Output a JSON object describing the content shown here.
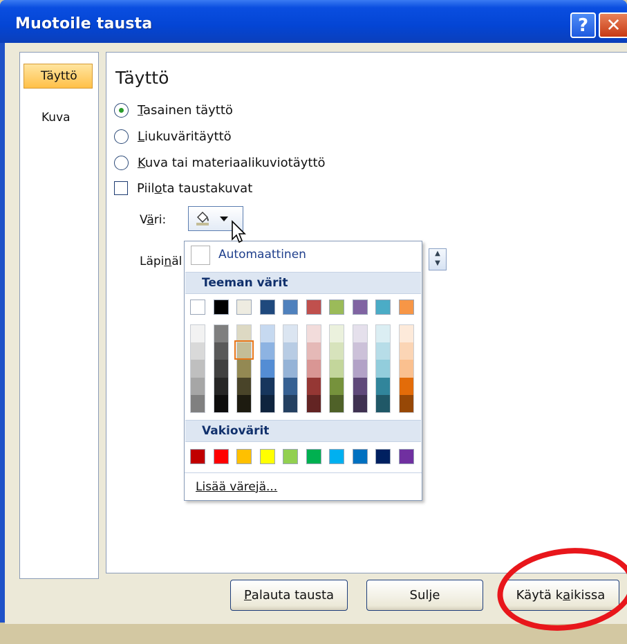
{
  "window": {
    "title": "Muotoile tausta",
    "help_label": "?",
    "close_label": "✕"
  },
  "nav": {
    "items": [
      {
        "label": "Täyttö",
        "active": true
      },
      {
        "label": "Kuva",
        "active": false
      }
    ]
  },
  "panel": {
    "section_title": "Täyttö",
    "options": [
      {
        "prefix": "",
        "u": "T",
        "rest": "asainen täyttö",
        "selected": true
      },
      {
        "prefix": "",
        "u": "L",
        "rest": "iukuväritäyttö",
        "selected": false
      },
      {
        "prefix": "",
        "u": "K",
        "rest": "uva tai materiaalikuviotäyttö",
        "selected": false
      }
    ],
    "hide_bg": {
      "prefix": "Piil",
      "u": "o",
      "rest": "ta taustakuvat",
      "checked": false
    },
    "color_label": {
      "prefix": "V",
      "u": "ä",
      "rest": "ri:"
    },
    "transparency_label": {
      "prefix": "Läpi",
      "u": "n",
      "rest": "äl"
    },
    "spin_up": "▲",
    "spin_down": "▼"
  },
  "color_menu": {
    "automatic_label": "Automaattinen",
    "theme_header": "Teeman värit",
    "standard_header": "Vakiovärit",
    "more_colors": "Lisää värejä...",
    "theme_top": [
      "#ffffff",
      "#000000",
      "#eeece1",
      "#1f497d",
      "#4f81bd",
      "#c0504d",
      "#9bbb59",
      "#8064a2",
      "#4bacc6",
      "#f79646"
    ],
    "theme_shades": [
      [
        "#f2f2f2",
        "#d9d9d9",
        "#bfbfbf",
        "#a6a6a6",
        "#808080"
      ],
      [
        "#7f7f7f",
        "#595959",
        "#404040",
        "#262626",
        "#0d0d0d"
      ],
      [
        "#ddd9c3",
        "#c4bd97",
        "#938953",
        "#494429",
        "#1d1b10"
      ],
      [
        "#c6d9f0",
        "#8db3e2",
        "#548dd4",
        "#17365d",
        "#0f243e"
      ],
      [
        "#dbe5f1",
        "#b8cce4",
        "#95b3d7",
        "#366092",
        "#244061"
      ],
      [
        "#f2dcdb",
        "#e5b9b7",
        "#d99694",
        "#953734",
        "#632423"
      ],
      [
        "#ebf1dd",
        "#d7e3bc",
        "#c3d69b",
        "#76923c",
        "#4f6128"
      ],
      [
        "#e5e0ec",
        "#ccc1d9",
        "#b2a2c7",
        "#5f497a",
        "#3f3151"
      ],
      [
        "#dbeef3",
        "#b7dde8",
        "#92cddc",
        "#31859b",
        "#205867"
      ],
      [
        "#fdeada",
        "#fbd5b5",
        "#fac08f",
        "#e36c09",
        "#974806"
      ]
    ],
    "standard": [
      "#c00000",
      "#ff0000",
      "#ffc000",
      "#ffff00",
      "#92d050",
      "#00b050",
      "#00b0f0",
      "#0070c0",
      "#002060",
      "#7030a0"
    ],
    "selected_index": [
      2,
      1
    ]
  },
  "buttons": {
    "reset": {
      "prefix": "",
      "u": "P",
      "rest": "alauta tausta"
    },
    "close": {
      "prefix": "",
      "u": "",
      "rest": "Sulje"
    },
    "apply_all": {
      "prefix": "Käytä k",
      "u": "a",
      "rest": "ikissa"
    }
  },
  "colors": {
    "accent": "#e8161b",
    "title_bar": "#0445d4",
    "selection": "#ffc048"
  }
}
